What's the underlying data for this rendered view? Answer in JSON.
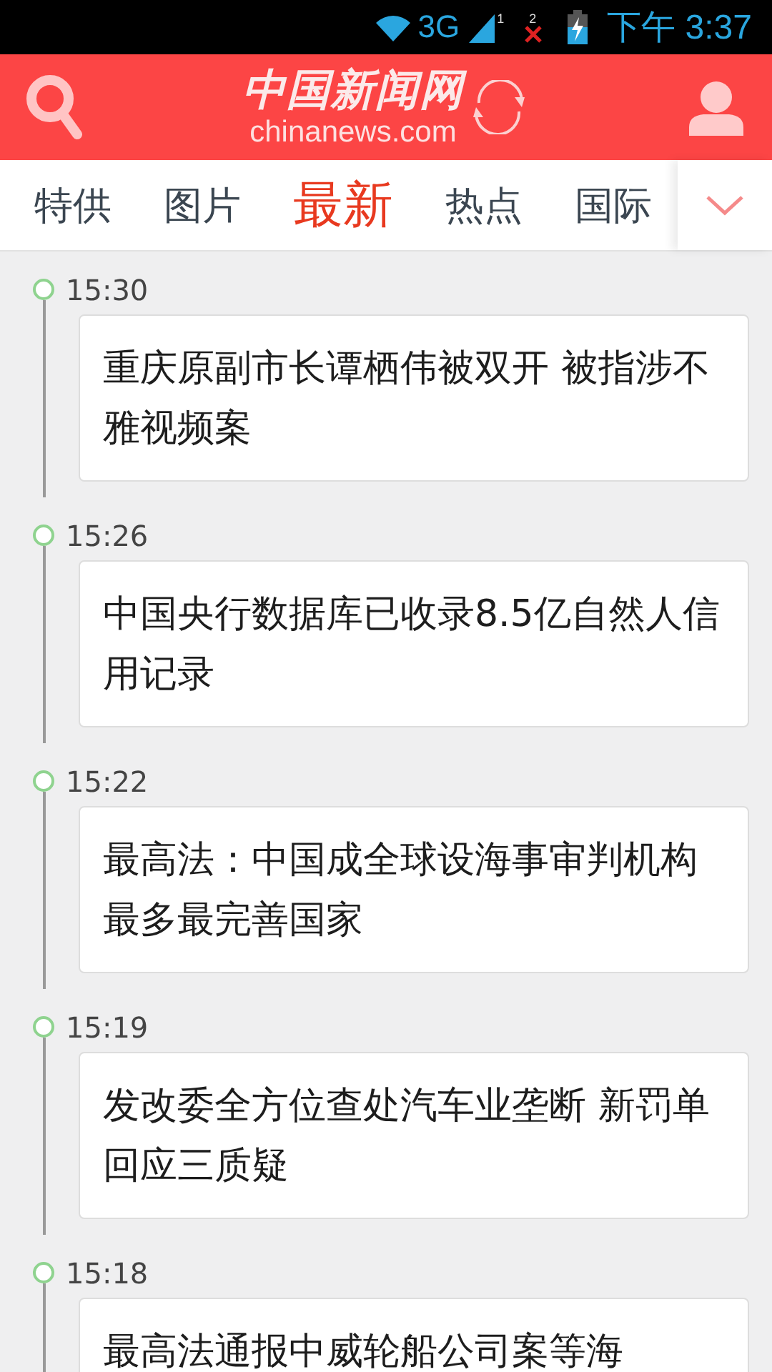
{
  "status_bar": {
    "network": "3G",
    "sim1_label": "1",
    "sim2_label": "2",
    "time": "下午 3:37"
  },
  "header": {
    "logo_title": "中国新闻网",
    "logo_domain": "chinanews.com"
  },
  "tabs": [
    {
      "label": "特供",
      "selected": false
    },
    {
      "label": "图片",
      "selected": false
    },
    {
      "label": "最新",
      "selected": true
    },
    {
      "label": "热点",
      "selected": false
    },
    {
      "label": "国际",
      "selected": false
    }
  ],
  "news": [
    {
      "time": "15:30",
      "headline": "重庆原副市长谭栖伟被双开 被指涉不雅视频案"
    },
    {
      "time": "15:26",
      "headline": "中国央行数据库已收录8.5亿自然人信用记录"
    },
    {
      "time": "15:22",
      "headline": "最高法：中国成全球设海事审判机构最多最完善国家"
    },
    {
      "time": "15:19",
      "headline": "发改委全方位查处汽车业垄断 新罚单回应三质疑"
    },
    {
      "time": "15:18",
      "headline": "最高法通报中威轮船公司案等海"
    }
  ]
}
